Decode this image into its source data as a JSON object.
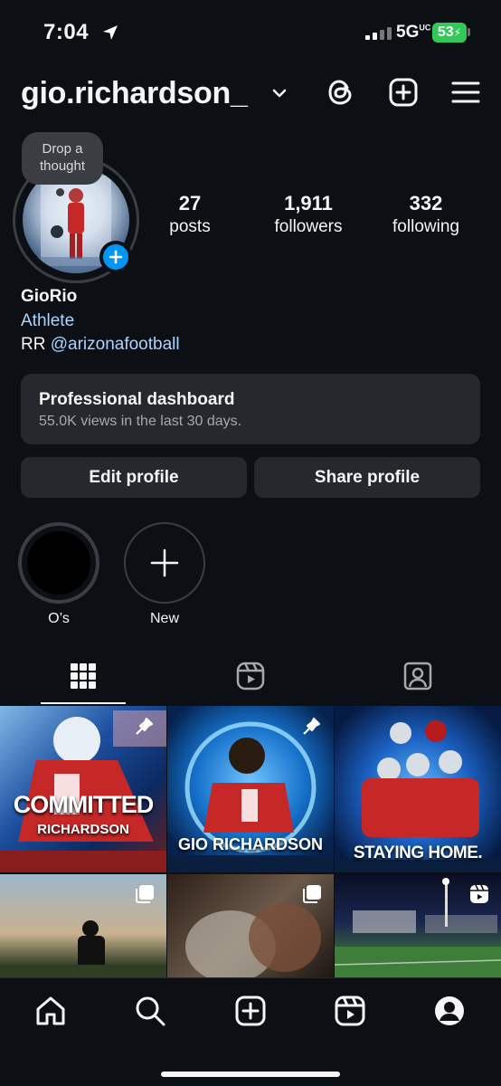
{
  "status_bar": {
    "time": "7:04",
    "network": "5G",
    "network_sup": "UC",
    "battery": "53"
  },
  "header": {
    "username": "gio.richardson_"
  },
  "profile": {
    "note": "Drop a thought",
    "stats": [
      {
        "value": "27",
        "label": "posts"
      },
      {
        "value": "1,911",
        "label": "followers"
      },
      {
        "value": "332",
        "label": "following"
      }
    ],
    "display_name": "GioRio",
    "category": "Athlete",
    "bio_prefix": "RR",
    "bio_mention": "@arizonafootball"
  },
  "dashboard": {
    "title": "Professional dashboard",
    "subtitle": "55.0K views in the last 30 days."
  },
  "buttons": {
    "edit": "Edit profile",
    "share": "Share profile"
  },
  "highlights": [
    {
      "label": "O’s"
    },
    {
      "label": "New"
    }
  ],
  "posts": [
    {
      "caption_main": "COMMITTED",
      "caption_sub": "RICHARDSON",
      "pinned": true
    },
    {
      "caption_main": "GIO RICHARDSON",
      "caption_sub": "",
      "pinned": true
    },
    {
      "caption_main": "STAYING HOME.",
      "caption_sub": "",
      "pinned": false
    }
  ],
  "colors": {
    "background": "#0c1014",
    "accent": "#0095f6",
    "link": "#a8d4ff",
    "card": "#25292e",
    "battery": "#34c759"
  }
}
